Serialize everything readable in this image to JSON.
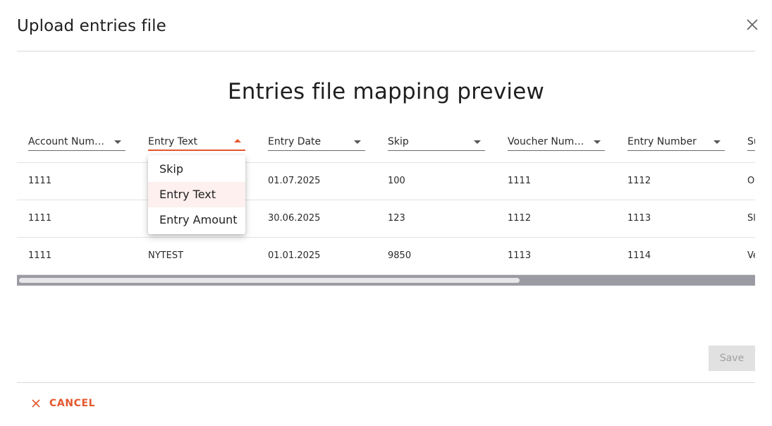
{
  "dialog": {
    "title": "Upload entries file",
    "close_icon": "close-icon",
    "heading": "Entries file mapping preview"
  },
  "table": {
    "columns": [
      {
        "label": "Account Numb...",
        "open": false
      },
      {
        "label": "Entry Text",
        "open": true
      },
      {
        "label": "Entry Date",
        "open": false
      },
      {
        "label": "Skip",
        "open": false
      },
      {
        "label": "Voucher Numb...",
        "open": false
      },
      {
        "label": "Entry Number",
        "open": false
      },
      {
        "label": "Su",
        "open": false
      }
    ],
    "rows": [
      [
        "1111",
        "",
        "01.07.2025",
        "100",
        "1111",
        "1112",
        "O"
      ],
      [
        "1111",
        "",
        "30.06.2025",
        "123",
        "1112",
        "1113",
        "Sl"
      ],
      [
        "1111",
        "NYTEST",
        "01.01.2025",
        "9850",
        "1113",
        "1114",
        "Ve"
      ]
    ]
  },
  "dropdown": {
    "options": [
      "Skip",
      "Entry Text",
      "Entry Amount"
    ],
    "selected": "Entry Text"
  },
  "footer": {
    "save_label": "Save",
    "cancel_label": "CANCEL",
    "cancel_icon": "close-icon"
  },
  "colors": {
    "accent": "#e4572e",
    "selected_bg": "#fdf0ee",
    "scrollbar_track": "#9b9ba3"
  }
}
